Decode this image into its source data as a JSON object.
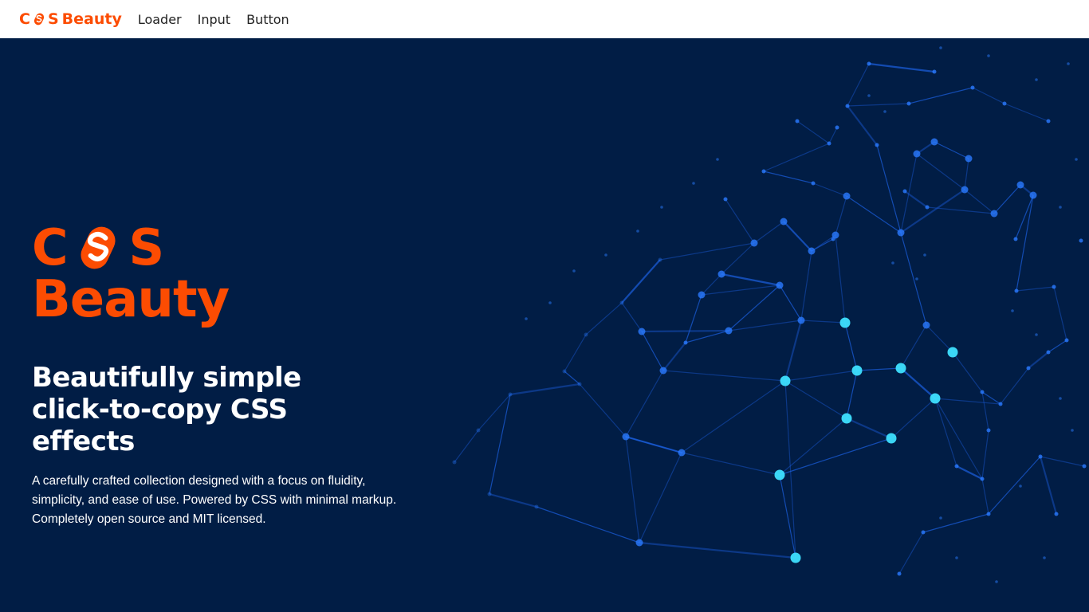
{
  "nav": {
    "brand_c": "C",
    "brand_s": "S",
    "brand_word": "Beauty",
    "links": [
      "Loader",
      "Input",
      "Button"
    ]
  },
  "hero": {
    "logo_c": "C",
    "logo_s": "S",
    "logo_word": "Beauty",
    "title_lines": [
      "Beautifully simple",
      "click-to-copy CSS",
      "effects"
    ],
    "description": "A carefully crafted collection designed with a focus on fluidity, simplicity, and ease of use. Powered by CSS with minimal markup. Completely open source and MIT licensed."
  },
  "colors": {
    "brand": "#fc4c02",
    "hero_bg": "#011d45",
    "network_line": "#1a5bd6",
    "network_node": "#2a7bff",
    "network_glow": "#3ee0ff"
  },
  "icons": {
    "brand_logo": "svelte-s-logo-icon",
    "network_background": "network-graph-illustration"
  }
}
